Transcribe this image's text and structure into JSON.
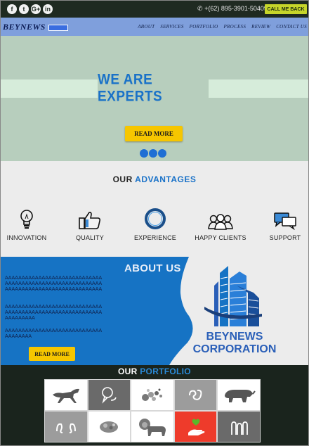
{
  "topbar": {
    "social": [
      {
        "icon": "facebook-icon",
        "glyph": "f"
      },
      {
        "icon": "twitter-icon",
        "glyph": "t"
      },
      {
        "icon": "google-plus-icon",
        "glyph": "G+"
      },
      {
        "icon": "linkedin-icon",
        "glyph": "in"
      }
    ],
    "phone_icon": "phone-icon",
    "phone": "+(62) 895-3901-50409",
    "call_button": "CALL ME BACK"
  },
  "nav": {
    "logo": "BEYNEWS",
    "items": [
      "ABOUT",
      "SERVICES",
      "PORTFOLIO",
      "PROCESS",
      "REVIEW",
      "CONTACT US"
    ]
  },
  "hero": {
    "title": "WE ARE EXPERTS",
    "button": "READ MORE",
    "slide_count": 3,
    "accent": "#1a72c8"
  },
  "advantages": {
    "title_part1": "OUR",
    "title_part2": "ADVANTAGES",
    "items": [
      {
        "label": "INNOVATION",
        "icon": "lightbulb-icon"
      },
      {
        "label": "QUALITY",
        "icon": "thumbs-up-icon"
      },
      {
        "label": "EXPERIENCE",
        "icon": "ring-icon"
      },
      {
        "label": "HAPPY CLIENTS",
        "icon": "group-icon"
      },
      {
        "label": "SUPPORT",
        "icon": "chat-icon"
      }
    ]
  },
  "about": {
    "heading": "ABOUT US",
    "paragraphs": [
      "AAAAAAAAAAAAAAAAAAAAAAAAAAAAAAAAAAAAAAAAAAAAAAAAAAAAAAAAAAAAAAAAAAAAAAAAAAAAAAAAAAAAAAA",
      "AAAAAAAAAAAAAAAAAAAAAAAAAAAAAAAAAAAAAAAAAAAAAAAAAAAAAAAAAAAAAAAAAAA",
      "AAAAAAAAAAAAAAAAAAAAAAAAAAAAAAAAAAAAA"
    ],
    "button": "READ MORE",
    "corp_line1": "BEYNEWS",
    "corp_line2": "CORPORATION"
  },
  "portfolio": {
    "title_part1": "OUR",
    "title_part2": "PORTFOLIO",
    "items": [
      {
        "icon": "horse-icon",
        "bg": "#ffffff"
      },
      {
        "icon": "speech-bubbles-icon",
        "bg": "#6a6a6a"
      },
      {
        "icon": "dots-cloud-icon",
        "bg": "#ffffff"
      },
      {
        "icon": "ornament-icon",
        "bg": "#9c9c9c"
      },
      {
        "icon": "rhino-icon",
        "bg": "#ffffff"
      },
      {
        "icon": "hands-icon",
        "bg": "#9c9c9c"
      },
      {
        "icon": "brain-icon",
        "bg": "#ffffff"
      },
      {
        "icon": "lion-icon",
        "bg": "#ffffff"
      },
      {
        "icon": "hand-heart-icon",
        "bg": "#ee3b2b"
      },
      {
        "icon": "pillars-icon",
        "bg": "#6a6a6a"
      }
    ]
  }
}
